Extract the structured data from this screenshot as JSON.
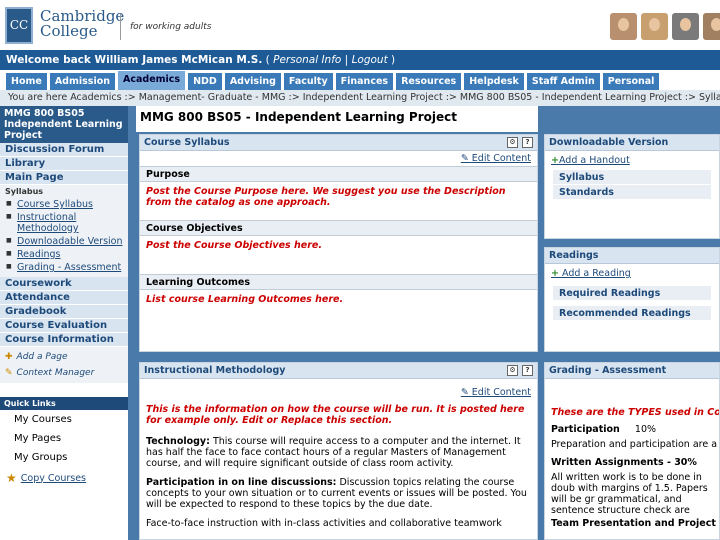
{
  "header": {
    "logo_mark": "CC",
    "logo_line1": "Cambridge",
    "logo_line2": "College",
    "tagline": "for working adults"
  },
  "welcome": {
    "text": "Welcome back William James McMican M.S.",
    "open": "( ",
    "personal_info": "Personal Info",
    "sep": " | ",
    "logout": "Logout",
    "close": " )"
  },
  "tabs": [
    "Home",
    "Admission",
    "Academics",
    "NDD",
    "Advising",
    "Faculty",
    "Finances",
    "Resources",
    "Helpdesk",
    "Staff Admin",
    "Personal"
  ],
  "active_tab": "Academics",
  "breadcrumb": "You are here  Academics :> Management- Graduate - MMG :> Independent Learning Project :> MMG 800 BS05 - Independent Learning Project :> Syllabus",
  "sidebar": {
    "course_title": "MMG 800 BS05 Independent Learning Project",
    "top_items": [
      "Discussion Forum",
      "Library",
      "Main Page"
    ],
    "syllabus_label": "Syllabus",
    "syllabus_links": [
      "Course Syllabus",
      "Instructional Methodology",
      "Downloadable Version",
      "Readings",
      "Grading - Assessment"
    ],
    "bottom_items": [
      "Coursework",
      "Attendance",
      "Gradebook",
      "Course Evaluation",
      "Course Information"
    ],
    "tools": [
      "Add a Page",
      "Context Manager"
    ],
    "quick_links_title": "Quick Links",
    "quick_links": [
      "My Courses",
      "My Pages",
      "My Groups",
      "Copy Courses"
    ]
  },
  "main": {
    "title": "MMG 800 BS05 - Independent Learning Project",
    "syllabus": {
      "header": "Course Syllabus",
      "edit": "Edit Content",
      "sections": [
        {
          "title": "Purpose",
          "text": "Post the Course Purpose here.  We suggest you use the Description from the catalog as one approach."
        },
        {
          "title": "Course Objectives",
          "text": "Post the Course Objectives here."
        },
        {
          "title": "Learning Outcomes",
          "text": "List course Learning Outcomes here."
        }
      ]
    },
    "method": {
      "header": "Instructional Methodology",
      "edit": "Edit Content",
      "intro": "This is the information on how the course will be run.  It is posted here for example only.    Edit or Replace this section.",
      "p1_bold": "Technology:",
      "p1": " This course will require access to a computer and the internet. It has half the face to face contact hours of a regular Masters of Management course, and will require significant outside of class room activity.",
      "p2_bold": "Participation in on line discussions:",
      "p2": " Discussion topics relating the course concepts to your own situation or to current events or issues will be posted. You will be expected to respond to these topics by the due date.",
      "p3": "Face-to-face instruction with in-class activities and collaborative teamwork"
    }
  },
  "right": {
    "download": {
      "header": "Downloadable Version",
      "add": "Add a Handout",
      "items": [
        "Syllabus",
        "Standards"
      ]
    },
    "readings": {
      "header": "Readings",
      "add": "Add a Reading",
      "items": [
        "Required Readings",
        "Recommended Readings"
      ]
    },
    "grading": {
      "header": "Grading - Assessment",
      "intro": "These are the TYPES used in Course section with your own material.",
      "part_label": "Participation",
      "part_pct": "10%",
      "part_text": "Preparation and participation are a",
      "written_label": "Written Assignments - 30%",
      "written_text": "All written work is to be done in doub with margins of 1.5. Papers will be gr grammatical, and sentence structure check are strongly recommended.",
      "team": "Team Presentation and Project - 2"
    }
  }
}
